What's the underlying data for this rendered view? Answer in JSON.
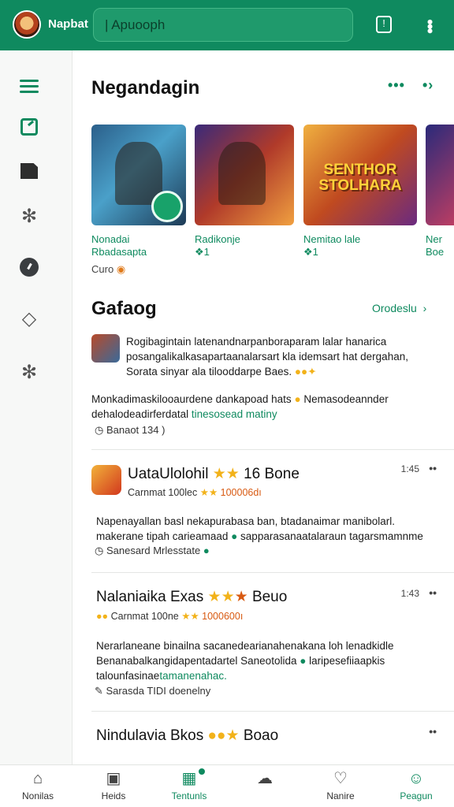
{
  "topbar": {
    "brand": "Napbat",
    "search_text": "| Apuooph",
    "notif_icon": "square-bell-icon",
    "menu_icon": "kebab-icon",
    "bg_color": "#0f8a5f"
  },
  "sidebar": {
    "items": [
      "menu-icon",
      "edit-icon",
      "flag-icon",
      "puzzle-icon",
      "clock-icon",
      "tag-icon",
      "puzzle-icon"
    ]
  },
  "section1": {
    "title": "Negandagin",
    "cards": [
      {
        "name": "Nonadai",
        "sub": "Rbadasapta"
      },
      {
        "name": "Radikonje",
        "sub": "❖1"
      },
      {
        "name": "Nemitao lale",
        "sub": "❖1",
        "logo": "SENTHOR STOLHARA"
      },
      {
        "name": "Ner",
        "sub": "Boe"
      }
    ],
    "foot": "Curo"
  },
  "section2": {
    "title": "Gafaog",
    "see_all": "Orodeslu",
    "post": {
      "line1": "Rogibagintain latenandnarpanboraparam lalar hanarica",
      "line2": "posangalikalkasapartaanalarsart kla idemsart hat dergahan,",
      "line3": "Sorata sinyar ala tilooddarpe Baes.",
      "body1": "Monkadimaskilooaurdene dankapoad hats",
      "body1b": "Nemasodeannder",
      "body2": "dehalodeadirferdatal",
      "body2b": "tinesosead matiny",
      "meta": "Banaot 134 )"
    }
  },
  "items": [
    {
      "title": "UataUlolohil",
      "title_tail": "16 Bone",
      "sub": "Carnmat 100lec",
      "sub_tail": "100006dı",
      "time": "1:45",
      "body1": "Napenayallan basl nekapurabasa ban, btadanaimar manibolarl.",
      "body2": "makerane tipah carieamaad",
      "body2b": "sapparasanaatalaraun tagarsmamnme",
      "link": "Sanesard Mrlesstate"
    },
    {
      "title": "Nalaniaika Exas",
      "title_tail": "Beuo",
      "sub": "Carnmat 100ne",
      "sub_tail": "1000600ı",
      "time": "1:43",
      "body1": "Nerarlaneane binailna sacanedearianahenakana loh lenadkidle",
      "body2": "Benanabalkangidapentadartel Saneotolida",
      "body2b": "laripesefiiaapkis",
      "body3": "talounfasinae",
      "body3b": "tamanenahac.",
      "link": "Sarasda TIDI doenelny"
    },
    {
      "title": "Nindulavia Bkos",
      "title_tail": "Boao"
    }
  ],
  "bottom_nav": [
    {
      "label": "Nonilas",
      "icon": "home-icon"
    },
    {
      "label": "Heids",
      "icon": "calendar-icon"
    },
    {
      "label": "Tentunls",
      "icon": "chart-icon",
      "active": true
    },
    {
      "label": "",
      "icon": "cloud-icon"
    },
    {
      "label": "Nanire",
      "icon": "heart-icon"
    },
    {
      "label": "Peagun",
      "icon": "user-icon",
      "active": true
    }
  ]
}
